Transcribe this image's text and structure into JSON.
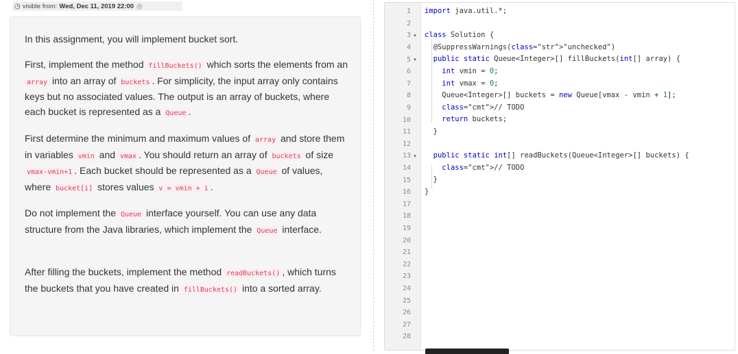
{
  "visibility": {
    "prefix": "visible from:",
    "date": "Wed, Dec 11, 2019 22:00"
  },
  "description": {
    "p1": "In this assignment, you will implement bucket sort.",
    "p2": [
      {
        "t": "First, implement the method "
      },
      {
        "c": "fillBuckets()"
      },
      {
        "t": " which sorts the elements from an "
      },
      {
        "c": "array"
      },
      {
        "t": " into an array of "
      },
      {
        "c": "buckets"
      },
      {
        "t": ". For simplicity, the input array only contains keys but no associated values. The output is an array of buckets, where each bucket is represented as a "
      },
      {
        "c": "Queue"
      },
      {
        "t": "."
      }
    ],
    "p3": [
      {
        "t": "First determine the minimum and maximum values of "
      },
      {
        "c": "array"
      },
      {
        "t": " and store them in variables "
      },
      {
        "c": "vmin"
      },
      {
        "t": " and "
      },
      {
        "c": "vmax"
      },
      {
        "t": ". You should return an array of "
      },
      {
        "c": "buckets"
      },
      {
        "t": " of size "
      },
      {
        "c": "vmax-vmin+1"
      },
      {
        "t": ". Each bucket should be represented as a "
      },
      {
        "c": "Queue"
      },
      {
        "t": " of values, where "
      },
      {
        "c": "bucket[i]"
      },
      {
        "t": " stores values "
      },
      {
        "c": "v = vmin + i"
      },
      {
        "t": "."
      }
    ],
    "p4": [
      {
        "t": "Do not implement the "
      },
      {
        "c": "Queue"
      },
      {
        "t": " interface yourself. You can use any data structure from the Java libraries, which implement the "
      },
      {
        "c": "Queue"
      },
      {
        "t": " interface."
      }
    ],
    "p5": [
      {
        "t": "After filling the buckets, implement the method "
      },
      {
        "c": "readBuckets()"
      },
      {
        "t": ", which turns the buckets that you have created in "
      },
      {
        "c": "fillBuckets()"
      },
      {
        "t": " into a sorted array."
      }
    ]
  },
  "editor": {
    "line_count": 28,
    "fold_lines": [
      3,
      5,
      13
    ],
    "lines": [
      "import java.util.*;",
      "",
      "class Solution {",
      "  @SuppressWarnings(\"unchecked\")",
      "  public static Queue<Integer>[] fillBuckets(int[] array) {",
      "    int vmin = 0;",
      "    int vmax = 0;",
      "    Queue<Integer>[] buckets = new Queue[vmax - vmin + 1];",
      "    // TODO",
      "    return buckets;",
      "  }",
      "",
      "  public static int[] readBuckets(Queue<Integer>[] buckets) {",
      "    // TODO",
      "  }",
      "}"
    ]
  }
}
